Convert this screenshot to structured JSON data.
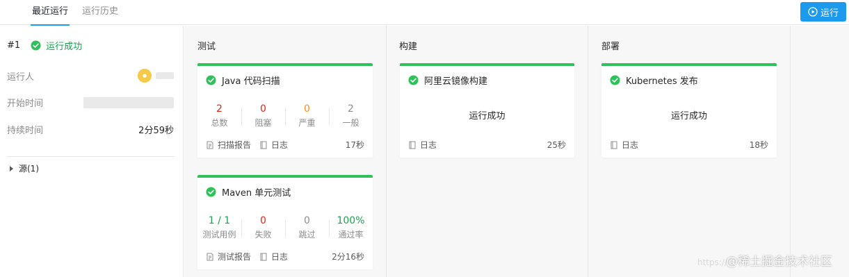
{
  "tabs": {
    "recent": "最近运行",
    "history": "运行历史"
  },
  "run_button": {
    "label": "运行",
    "color": "#1b9aee"
  },
  "summary": {
    "run_number": "#1",
    "status": "运行成功",
    "runner_label": "运行人",
    "start_label": "开始时间",
    "duration_label": "持续时间",
    "duration_value": "2分59秒",
    "source_label": "源(1)"
  },
  "stages": [
    {
      "title": "测试",
      "jobs": [
        {
          "name": "Java 代码扫描",
          "stats": [
            {
              "value": "2",
              "label": "总数",
              "color": "#e62412"
            },
            {
              "value": "0",
              "label": "阻塞",
              "color": "#e62412"
            },
            {
              "value": "0",
              "label": "严重",
              "color": "#fa8c16"
            },
            {
              "value": "2",
              "label": "一般",
              "color": "#8c8c8c"
            }
          ],
          "report_label": "扫描报告",
          "log_label": "日志",
          "duration": "17秒"
        },
        {
          "name": "Maven 单元测试",
          "stats": [
            {
              "value": "1 / 1",
              "label": "测试用例",
              "color": "#1aa251"
            },
            {
              "value": "0",
              "label": "失败",
              "color": "#e62412"
            },
            {
              "value": "0",
              "label": "跳过",
              "color": "#8c8c8c"
            },
            {
              "value": "100%",
              "label": "通过率",
              "color": "#1aa251"
            }
          ],
          "report_label": "测试报告",
          "log_label": "日志",
          "duration": "2分16秒"
        }
      ]
    },
    {
      "title": "构建",
      "jobs": [
        {
          "name": "阿里云镜像构建",
          "message": "运行成功",
          "log_label": "日志",
          "duration": "25秒"
        }
      ]
    },
    {
      "title": "部署",
      "jobs": [
        {
          "name": "Kubernetes 发布",
          "message": "运行成功",
          "log_label": "日志",
          "duration": "18秒"
        }
      ]
    }
  ],
  "watermark": {
    "text": "@稀土掘金技术社区"
  },
  "colors": {
    "success": "#2fc25b",
    "primary": "#1b9aee"
  }
}
